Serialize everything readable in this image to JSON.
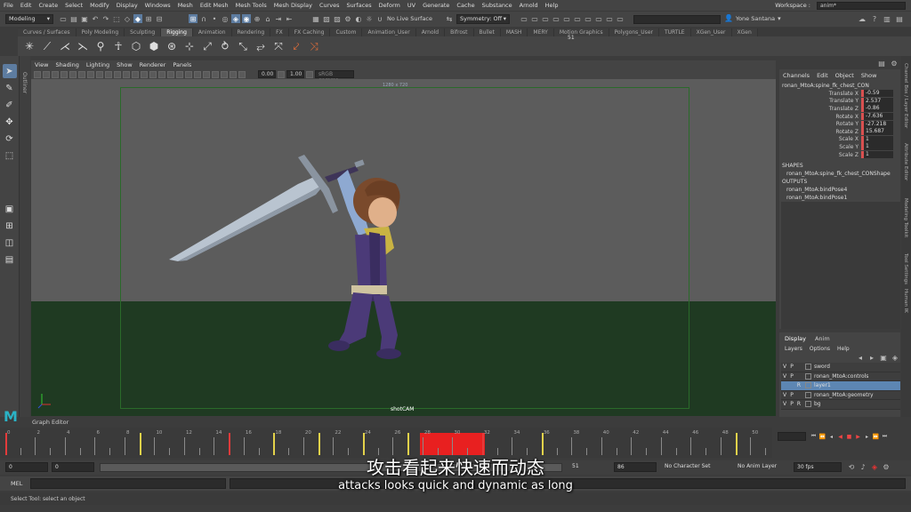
{
  "menubar": {
    "items": [
      "File",
      "Edit",
      "Create",
      "Select",
      "Modify",
      "Display",
      "Windows",
      "Mesh",
      "Edit Mesh",
      "Mesh Tools",
      "Mesh Display",
      "Curves",
      "Surfaces",
      "Deform",
      "UV",
      "Generate",
      "Cache",
      "Substance",
      "Arnold",
      "Help"
    ],
    "workspace_label": "Workspace :",
    "workspace_value": "anim*"
  },
  "statusline": {
    "mode": "Modeling",
    "live_surface": "No Live Surface",
    "symmetry": "Symmetry: Off",
    "user": "Yone Santana"
  },
  "shelf": {
    "tabs": [
      "Curves / Surfaces",
      "Poly Modeling",
      "Sculpting",
      "Rigging",
      "Animation",
      "Rendering",
      "FX",
      "FX Caching",
      "Custom",
      "Animation_User",
      "Arnold",
      "Bifrost",
      "Bullet",
      "MASH",
      "MERY",
      "Motion Graphics",
      "Polygons_User",
      "TURTLE",
      "XGen_User",
      "XGen"
    ],
    "active_tab": "Rigging"
  },
  "outliner_tab": "Outliner",
  "viewport": {
    "menu": [
      "View",
      "Shading",
      "Lighting",
      "Show",
      "Renderer",
      "Panels"
    ],
    "exposure": "0.00",
    "gamma": "1.00",
    "color_space": "sRGB gamma",
    "resolution": "1280 x 720",
    "camera": "shotCAM",
    "colors": {
      "background": "#5c5c5c",
      "ground": "#1f3a22",
      "gate": "#2a6a2a"
    }
  },
  "channel_box": {
    "menu": [
      "Channels",
      "Edit",
      "Object",
      "Show"
    ],
    "object": "ronan_MtoA:spine_fk_chest_CON",
    "attributes": [
      {
        "name": "Translate X",
        "value": "-0.59"
      },
      {
        "name": "Translate Y",
        "value": "2.537"
      },
      {
        "name": "Translate Z",
        "value": "-0.86"
      },
      {
        "name": "Rotate X",
        "value": "-7.636"
      },
      {
        "name": "Rotate Y",
        "value": "-27.218"
      },
      {
        "name": "Rotate Z",
        "value": "15.687"
      },
      {
        "name": "Scale X",
        "value": "1"
      },
      {
        "name": "Scale Y",
        "value": "1"
      },
      {
        "name": "Scale Z",
        "value": "1"
      }
    ],
    "shapes_label": "SHAPES",
    "shapes": [
      "ronan_MtoA:spine_fk_chest_CONShape"
    ],
    "outputs_label": "OUTPUTS",
    "outputs": [
      "ronan_MtoA:bindPose4",
      "ronan_MtoA:bindPose1"
    ]
  },
  "right_tabs": [
    "Channel Box / Layer Editor",
    "Attribute Editor",
    "Modeling Toolkit",
    "Tool Settings",
    "Human IK"
  ],
  "layer_editor": {
    "tabs": [
      "Display",
      "Anim"
    ],
    "menu": [
      "Layers",
      "Options",
      "Help"
    ],
    "layers": [
      {
        "v": "V",
        "p": "P",
        "r": "",
        "name": "sword",
        "selected": false
      },
      {
        "v": "V",
        "p": "P",
        "r": "",
        "name": "ronan_MtoA:controls",
        "selected": false
      },
      {
        "v": "",
        "p": "",
        "r": "R",
        "name": "layer1",
        "selected": true
      },
      {
        "v": "V",
        "p": "P",
        "r": "",
        "name": "ronan_MtoA:geometry",
        "selected": false
      },
      {
        "v": "V",
        "p": "P",
        "r": "R",
        "name": "bg",
        "selected": false
      }
    ]
  },
  "graph_editor_label": "Graph Editor",
  "time_slider": {
    "start": 0,
    "end": 51,
    "labels": [
      "0",
      "2",
      "4",
      "6",
      "8",
      "10",
      "12",
      "14",
      "16",
      "18",
      "20",
      "22",
      "24",
      "26",
      "28",
      "30",
      "32",
      "34",
      "36",
      "38",
      "40",
      "42",
      "44",
      "46",
      "48",
      "50"
    ],
    "current_frame_display": "51",
    "red_keys": [
      0,
      15,
      32
    ],
    "yellow_keys": [
      9,
      18,
      21,
      24,
      27,
      32,
      36,
      49
    ],
    "highlight_range": [
      27.8,
      32.2
    ],
    "colors": {
      "yellow": "#e3d24a",
      "red": "#e43b3b"
    }
  },
  "range_slider": {
    "start_field": "0",
    "start_inner": "0",
    "end_inner": "51",
    "end_field": "86",
    "character_set": "No Character Set",
    "anim_layer": "No Anim Layer",
    "fps": "30 fps"
  },
  "mel": {
    "label": "MEL",
    "help": "Select Tool: select an object"
  },
  "subtitles": {
    "cn": "攻击看起来快速而动态",
    "en": "attacks looks quick and dynamic as long"
  },
  "logo": "M"
}
